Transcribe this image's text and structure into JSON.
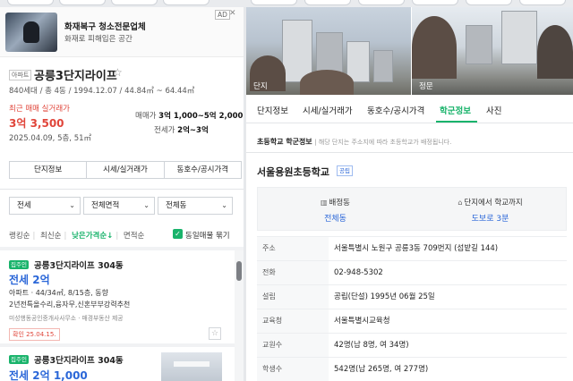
{
  "ad": {
    "badge": "AD",
    "close": "✕",
    "title": "화재복구 청소전문업체",
    "subtitle": "화재로 피해입은 공간"
  },
  "property": {
    "type_badge": "아파트",
    "name": "공릉3단지라이프",
    "star": "☆",
    "meta": "840세대 / 총 4동 / 1994.12.07 / 44.84㎡ ~ 64.44㎡",
    "recent_label": "최근 매매 실거래가",
    "recent_price": "3억 3,500",
    "recent_date": "2025.04.09, 5층, 51㎡",
    "sale_label": "매매가",
    "sale_range": "3억 1,000~5억 2,000",
    "jeonse_label": "전세가",
    "jeonse_range": "2억~3억"
  },
  "left_tabs": [
    "단지정보",
    "시세/실거래가",
    "동호수/공시가격"
  ],
  "filters": [
    "전세",
    "전체면적",
    "전체동"
  ],
  "sort_options": [
    "랭킹순",
    "최신순",
    "낮은가격순↓",
    "면적순"
  ],
  "same_listing_label": "동일매물 묶기",
  "listings": [
    {
      "tag": "집주인",
      "title": "공릉3단지라이프 304동",
      "price": "전세 2억",
      "spec": "아파트 · 44/34㎡, 8/15층, 동향",
      "desc": "2년전특올수리,융자무,신혼부부강력추천",
      "agent": "미성행동공인중개사사무소 · 매경부동산 제공",
      "confirm": "확인 25.04.15."
    },
    {
      "tag": "집주인",
      "title": "공릉3단지라이프 304동",
      "price": "전세 2억 1,000"
    }
  ],
  "photos": {
    "left_caption": "단지",
    "right_caption": "정문"
  },
  "right_tabs": [
    "단지정보",
    "시세/실거래가",
    "동호수/공시가격",
    "학군정보",
    "사진"
  ],
  "active_right_tab": "학군정보",
  "school": {
    "header_title": "초등학교 학군정보",
    "header_note": "해당 단지는 주소지에 따라 초등학교가 배정됩니다.",
    "name": "서울용원초등학교",
    "public_badge": "공립",
    "assigned_label": "배정동",
    "assigned_value": "전체동",
    "distance_label": "단지에서 학교까지",
    "distance_value": "도보로 3분",
    "rows": [
      {
        "k": "주소",
        "v": "서울특별시 노원구 공릉3동 709번지 (섬밭길 144)"
      },
      {
        "k": "전화",
        "v": "02-948-5302"
      },
      {
        "k": "설립",
        "v": "공립(단설) 1995년 06월 25일"
      },
      {
        "k": "교육청",
        "v": "서울특별시교육청"
      },
      {
        "k": "교원수",
        "v": "42명(남 8명, 여 34명)"
      },
      {
        "k": "학생수",
        "v": "542명(남 265명, 여 277명)"
      }
    ]
  },
  "colors": {
    "accent": "#19b36b",
    "price_red": "#e0453a",
    "price_blue": "#2b67d8"
  }
}
